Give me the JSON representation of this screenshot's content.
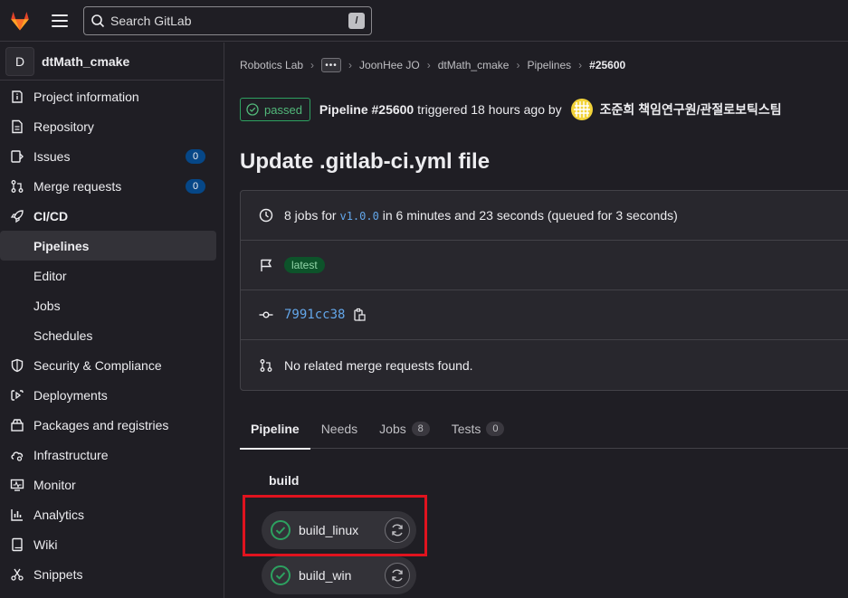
{
  "topbar": {
    "search_placeholder": "Search GitLab",
    "search_shortcut": "/"
  },
  "sidebar": {
    "project_initial": "D",
    "project_name": "dtMath_cmake",
    "items": [
      {
        "label": "Project information",
        "icon": "info-icon"
      },
      {
        "label": "Repository",
        "icon": "document-icon"
      },
      {
        "label": "Issues",
        "icon": "issues-icon",
        "count": "0"
      },
      {
        "label": "Merge requests",
        "icon": "merge-request-icon",
        "count": "0"
      },
      {
        "label": "CI/CD",
        "icon": "rocket-icon"
      },
      {
        "label": "Pipelines"
      },
      {
        "label": "Editor"
      },
      {
        "label": "Jobs"
      },
      {
        "label": "Schedules"
      },
      {
        "label": "Security & Compliance",
        "icon": "shield-icon"
      },
      {
        "label": "Deployments",
        "icon": "deployments-icon"
      },
      {
        "label": "Packages and registries",
        "icon": "package-icon"
      },
      {
        "label": "Infrastructure",
        "icon": "cloud-gear-icon"
      },
      {
        "label": "Monitor",
        "icon": "monitor-icon"
      },
      {
        "label": "Analytics",
        "icon": "chart-icon"
      },
      {
        "label": "Wiki",
        "icon": "book-icon"
      },
      {
        "label": "Snippets",
        "icon": "scissors-icon"
      }
    ]
  },
  "breadcrumb": {
    "items": [
      "Robotics Lab",
      "JoonHee JO",
      "dtMath_cmake",
      "Pipelines"
    ],
    "current": "#25600"
  },
  "pipeline": {
    "status": "passed",
    "name": "Pipeline #25600",
    "trigger_text": "triggered 18 hours ago by",
    "user": "조준희 책임연구원/관절로보틱스팀",
    "title": "Update .gitlab-ci.yml file",
    "jobs_prefix": "8 jobs for",
    "ref": "v1.0.0",
    "jobs_suffix": "in 6 minutes and 23 seconds (queued for 3 seconds)",
    "tag": "latest",
    "commit": "7991cc38",
    "mr_text": "No related merge requests found."
  },
  "tabs": [
    {
      "label": "Pipeline",
      "active": true
    },
    {
      "label": "Needs"
    },
    {
      "label": "Jobs",
      "count": "8"
    },
    {
      "label": "Tests",
      "count": "0"
    }
  ],
  "graph": {
    "stage": "build",
    "jobs": [
      {
        "name": "build_linux",
        "status": "success"
      },
      {
        "name": "build_win",
        "status": "success"
      }
    ]
  },
  "colors": {
    "success": "#2da160",
    "highlight": "#e0131e",
    "badge": "#064787"
  }
}
